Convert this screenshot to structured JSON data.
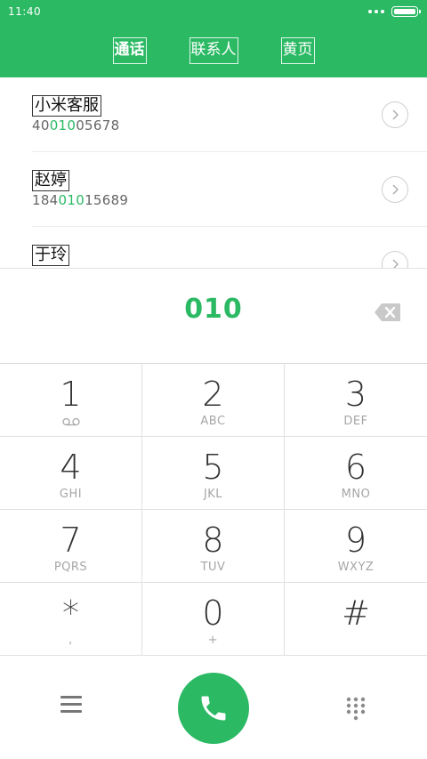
{
  "status_bar": {
    "time": "11:40"
  },
  "tabs": [
    {
      "label": "通话",
      "active": true
    },
    {
      "label": "联系人",
      "active": false
    },
    {
      "label": "黄页",
      "active": false
    }
  ],
  "contacts": [
    {
      "name": "小米客服",
      "number_pre": "40",
      "number_match": "010",
      "number_post": "05678"
    },
    {
      "name": "赵婷",
      "number_pre": "184",
      "number_match": "010",
      "number_post": "15689"
    },
    {
      "name": "于玲",
      "number_pre": "",
      "number_match": "",
      "number_post": ""
    }
  ],
  "dialed_number": "010",
  "keypad": [
    {
      "digit": "1",
      "sub": "",
      "sub_icon": "voicemail-icon"
    },
    {
      "digit": "2",
      "sub": "ABC"
    },
    {
      "digit": "3",
      "sub": "DEF"
    },
    {
      "digit": "4",
      "sub": "GHI"
    },
    {
      "digit": "5",
      "sub": "JKL"
    },
    {
      "digit": "6",
      "sub": "MNO"
    },
    {
      "digit": "7",
      "sub": "PQRS"
    },
    {
      "digit": "8",
      "sub": "TUV"
    },
    {
      "digit": "9",
      "sub": "WXYZ"
    },
    {
      "digit": "*",
      "sub": ","
    },
    {
      "digit": "0",
      "sub": "+"
    },
    {
      "digit": "#",
      "sub": ""
    }
  ],
  "colors": {
    "accent": "#2bb964",
    "header": "#2bb964",
    "divider": "#e0e0e0",
    "subtext": "#a6a6a6"
  }
}
